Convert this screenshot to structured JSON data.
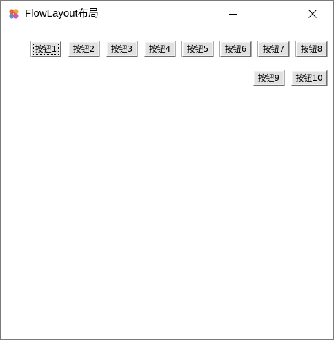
{
  "window": {
    "title": "FlowLayout布局",
    "app_icon": "java-coffee-cup-icon",
    "minimize_icon": "minimize-icon",
    "maximize_icon": "maximize-icon",
    "close_icon": "close-icon"
  },
  "buttons": [
    {
      "label": "按钮1",
      "focused": true
    },
    {
      "label": "按钮2"
    },
    {
      "label": "按钮3"
    },
    {
      "label": "按钮4"
    },
    {
      "label": "按钮5"
    },
    {
      "label": "按钮6"
    },
    {
      "label": "按钮7"
    },
    {
      "label": "按钮8"
    },
    {
      "label": "按钮9"
    },
    {
      "label": "按钮10"
    }
  ]
}
